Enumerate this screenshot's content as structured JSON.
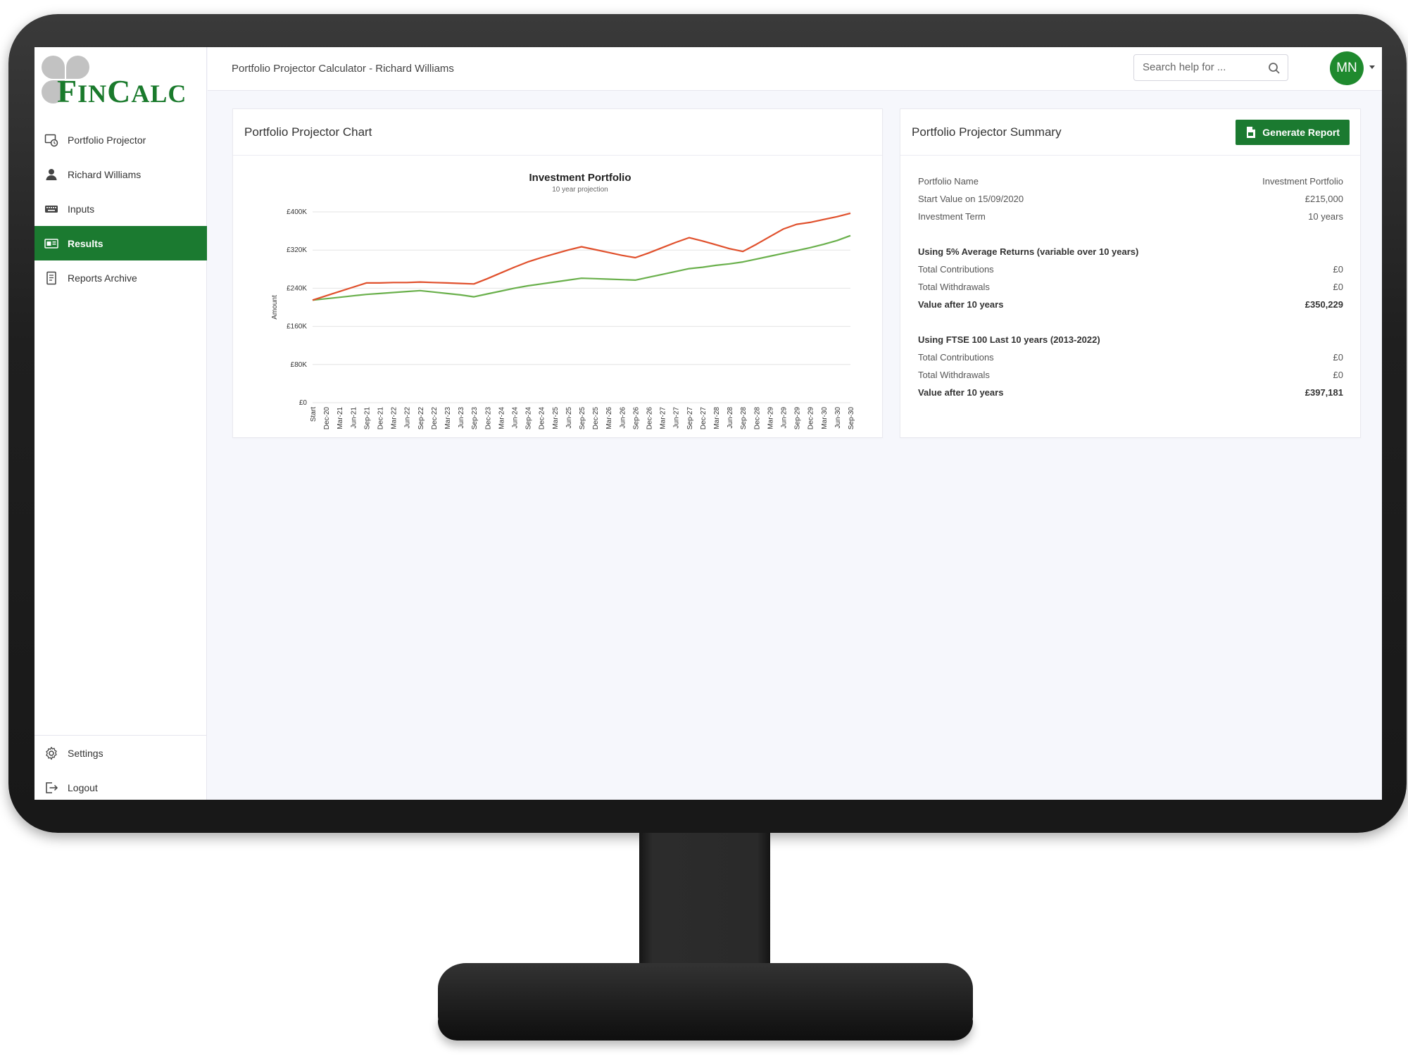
{
  "app": {
    "logo_text": "FINCALC",
    "logo_first": "F",
    "logo_mid": "IN",
    "logo_c": "C",
    "logo_end": "ALC"
  },
  "header": {
    "title": "Portfolio Projector Calculator - Richard Williams",
    "search_placeholder": "Search help for ...",
    "avatar_initials": "MN"
  },
  "sidebar": {
    "items": [
      {
        "label": "Portfolio Projector",
        "icon": "projector-icon",
        "active": false
      },
      {
        "label": "Richard Williams",
        "icon": "user-icon",
        "active": false
      },
      {
        "label": "Inputs",
        "icon": "keyboard-icon",
        "active": false
      },
      {
        "label": "Results",
        "icon": "results-icon",
        "active": true
      },
      {
        "label": "Reports Archive",
        "icon": "document-icon",
        "active": false
      }
    ],
    "bottom_items": [
      {
        "label": "Settings",
        "icon": "gear-icon"
      },
      {
        "label": "Logout",
        "icon": "logout-icon"
      }
    ]
  },
  "chart_card": {
    "title": "Portfolio Projector Chart"
  },
  "summary_card": {
    "title": "Portfolio Projector Summary",
    "button_label": "Generate Report",
    "rows_top": [
      {
        "label": "Portfolio Name",
        "value": "Investment Portfolio"
      },
      {
        "label": "Start Value on 15/09/2020",
        "value": "£215,000"
      },
      {
        "label": "Investment Term",
        "value": "10 years"
      }
    ],
    "section1": {
      "heading": "Using 5% Average Returns (variable over 10 years)",
      "rows": [
        {
          "label": "Total Contributions",
          "value": "£0"
        },
        {
          "label": "Total Withdrawals",
          "value": "£0"
        },
        {
          "label": "Value after 10 years",
          "value": "£350,229"
        }
      ]
    },
    "section2": {
      "heading": "Using FTSE 100 Last 10 years (2013-2022)",
      "rows": [
        {
          "label": "Total Contributions",
          "value": "£0"
        },
        {
          "label": "Total Withdrawals",
          "value": "£0"
        },
        {
          "label": "Value after 10 years",
          "value": "£397,181"
        }
      ]
    }
  },
  "colors": {
    "brand_green": "#1b7a30",
    "series_green": "#6ab04c",
    "series_red": "#e0502c"
  },
  "chart_data": {
    "type": "line",
    "title": "Investment Portfolio",
    "subtitle": "10 year projection",
    "xlabel": "",
    "ylabel": "Amount",
    "ylim": [
      0,
      400000
    ],
    "yticks": [
      0,
      80000,
      160000,
      240000,
      320000,
      400000
    ],
    "ytick_labels": [
      "£0",
      "£80K",
      "£160K",
      "£240K",
      "£320K",
      "£400K"
    ],
    "grid": true,
    "legend": "bottom",
    "x": [
      "Start",
      "Dec-20",
      "Mar-21",
      "Jun-21",
      "Sep-21",
      "Dec-21",
      "Mar-22",
      "Jun-22",
      "Sep-22",
      "Dec-22",
      "Mar-23",
      "Jun-23",
      "Sep-23",
      "Dec-23",
      "Mar-24",
      "Jun-24",
      "Sep-24",
      "Dec-24",
      "Mar-25",
      "Jun-25",
      "Sep-25",
      "Dec-25",
      "Mar-26",
      "Jun-26",
      "Sep-26",
      "Dec-26",
      "Mar-27",
      "Jun-27",
      "Sep-27",
      "Dec-27",
      "Mar-28",
      "Jun-28",
      "Sep-28",
      "Dec-28",
      "Mar-29",
      "Jun-29",
      "Sep-29",
      "Dec-29",
      "Mar-30",
      "Jun-30",
      "Sep-30"
    ],
    "series": [
      {
        "name": "5% Average Returns (variable over 10 years)",
        "color": "#6ab04c",
        "values": [
          215000,
          218000,
          221000,
          224000,
          227000,
          229000,
          231000,
          233000,
          235000,
          232000,
          229000,
          226000,
          222000,
          228000,
          234000,
          240000,
          245000,
          249000,
          253000,
          257000,
          261000,
          260000,
          259000,
          258000,
          257000,
          263000,
          269000,
          275000,
          281000,
          284000,
          288000,
          291000,
          295000,
          301000,
          307000,
          313000,
          319000,
          325000,
          332000,
          340000,
          350229
        ]
      },
      {
        "name": "FTSE 100 Last 10 years (2013-2022)",
        "color": "#e0502c",
        "values": [
          215000,
          224000,
          233000,
          242000,
          251000,
          251000,
          252000,
          252000,
          253000,
          252000,
          251000,
          250000,
          249000,
          260000,
          272000,
          284000,
          295000,
          304000,
          312000,
          320000,
          327000,
          321000,
          315000,
          309000,
          304000,
          314000,
          325000,
          336000,
          346000,
          339000,
          331000,
          323000,
          317000,
          332000,
          348000,
          364000,
          374000,
          378000,
          384000,
          390000,
          397181
        ]
      }
    ]
  }
}
